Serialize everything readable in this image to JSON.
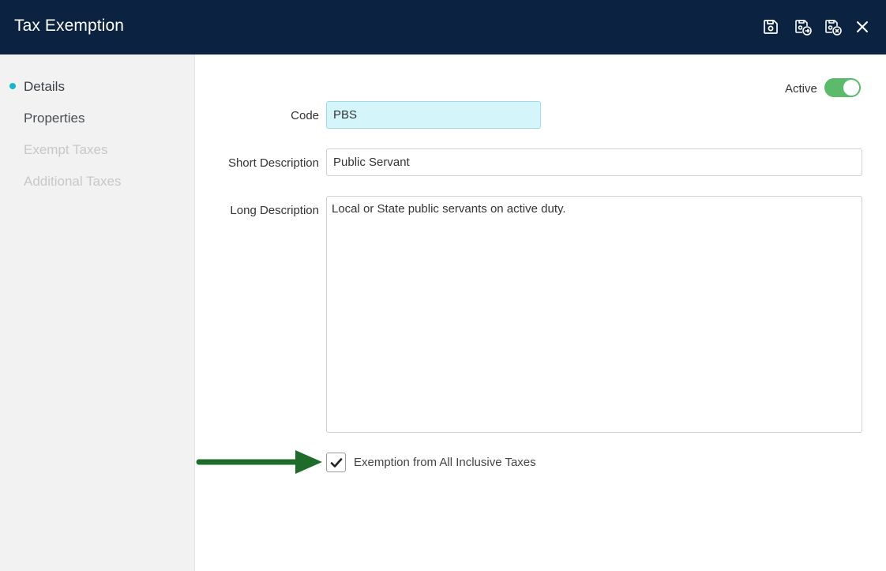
{
  "window": {
    "title": "Tax Exemption",
    "toolbar": {
      "save_icon": "save-icon",
      "save_and_new_icon": "save-and-new-icon",
      "save_and_close_icon": "save-and-close-icon",
      "close_icon": "close-icon"
    }
  },
  "sidebar": {
    "items": [
      {
        "label": "Details",
        "state": "selected"
      },
      {
        "label": "Properties",
        "state": "enabled"
      },
      {
        "label": "Exempt Taxes",
        "state": "disabled"
      },
      {
        "label": "Additional Taxes",
        "state": "disabled"
      }
    ]
  },
  "form": {
    "active": {
      "label": "Active",
      "value": true
    },
    "code": {
      "label": "Code",
      "value": "PBS"
    },
    "short_description": {
      "label": "Short Description",
      "value": "Public Servant"
    },
    "long_description": {
      "label": "Long Description",
      "value": "Local or State public servants on active duty."
    },
    "exemption_checkbox": {
      "label": "Exemption from All Inclusive Taxes",
      "checked": true
    }
  },
  "colors": {
    "titlebar": "#0b2240",
    "accent": "#1bb3cf",
    "toggle_on": "#5cbb6a",
    "code_field": "#d4f6fb",
    "annotation_arrow": "#1e6b2a"
  }
}
